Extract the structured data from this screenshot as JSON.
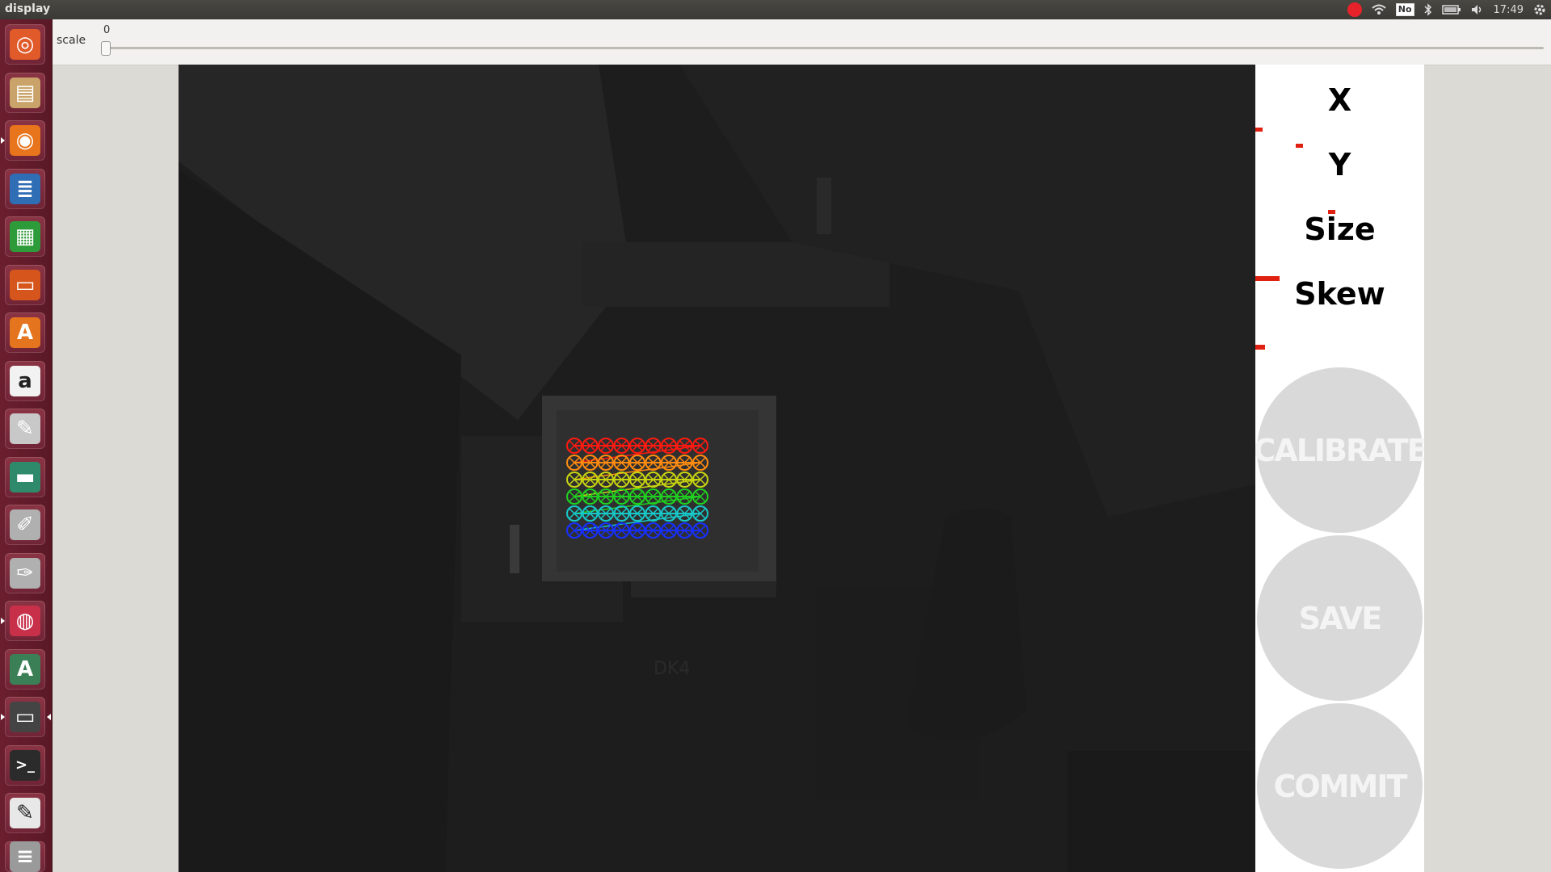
{
  "window_title": "display",
  "system_tray": {
    "keyboard_indicator": "No",
    "clock": "17:49",
    "icons": [
      "record-icon",
      "wifi-icon",
      "keyboard-layout-icon",
      "bluetooth-icon",
      "battery-icon",
      "volume-icon",
      "settings-gear-icon"
    ]
  },
  "launcher": {
    "items": [
      {
        "name": "ubuntu-dash-icon",
        "glyph": "◎",
        "color": "#e05a2a"
      },
      {
        "name": "files-icon",
        "glyph": "▤",
        "color": "#c9a36a"
      },
      {
        "name": "firefox-icon",
        "glyph": "◉",
        "color": "#e8741c"
      },
      {
        "name": "writer-icon",
        "glyph": "≣",
        "color": "#2f6db5"
      },
      {
        "name": "calc-icon",
        "glyph": "▦",
        "color": "#2e9b3a"
      },
      {
        "name": "impress-icon",
        "glyph": "▭",
        "color": "#d5551c"
      },
      {
        "name": "software-center-icon",
        "glyph": "A",
        "color": "#e5741f"
      },
      {
        "name": "amazon-icon",
        "glyph": "a",
        "color": "#f2f2f2"
      },
      {
        "name": "system-settings-icon",
        "glyph": "✎",
        "color": "#c8c8c8"
      },
      {
        "name": "hardware-icon",
        "glyph": "▬",
        "color": "#2e8a6b"
      },
      {
        "name": "paintbrush-icon",
        "glyph": "✐",
        "color": "#b0b0b0"
      },
      {
        "name": "paint-tube-icon",
        "glyph": "✑",
        "color": "#b0b0b0"
      },
      {
        "name": "ubuntu-one-icon",
        "glyph": "◍",
        "color": "#c8304a"
      },
      {
        "name": "software-updater-icon",
        "glyph": "A",
        "color": "#3a7f55"
      },
      {
        "name": "monitor-icon",
        "glyph": "▭",
        "color": "#444444"
      },
      {
        "name": "terminal-icon",
        "glyph": ">_",
        "color": "#2b2b2b"
      },
      {
        "name": "text-editor-icon",
        "glyph": "✎",
        "color": "#e8e8e8"
      },
      {
        "name": "workspace-icon",
        "glyph": "≡",
        "color": "#9a9a9a"
      }
    ]
  },
  "scale": {
    "label": "scale",
    "value": "0"
  },
  "panel": {
    "metrics": [
      {
        "label": "X",
        "level": 0.0
      },
      {
        "label": "Y",
        "level": 0.25
      },
      {
        "label": "Size",
        "level": 0.45
      },
      {
        "label": "Skew",
        "level": 0.0
      }
    ],
    "buttons": {
      "calibrate": "CALIBRATE",
      "save": "SAVE",
      "commit": "COMMIT"
    }
  },
  "camera": {
    "board_label": "DK4",
    "grid": {
      "rows": 6,
      "cols": 9
    },
    "row_colors": [
      "#ff1a10",
      "#ff8c10",
      "#c8d410",
      "#20d020",
      "#18c8c8",
      "#1830ff"
    ]
  }
}
